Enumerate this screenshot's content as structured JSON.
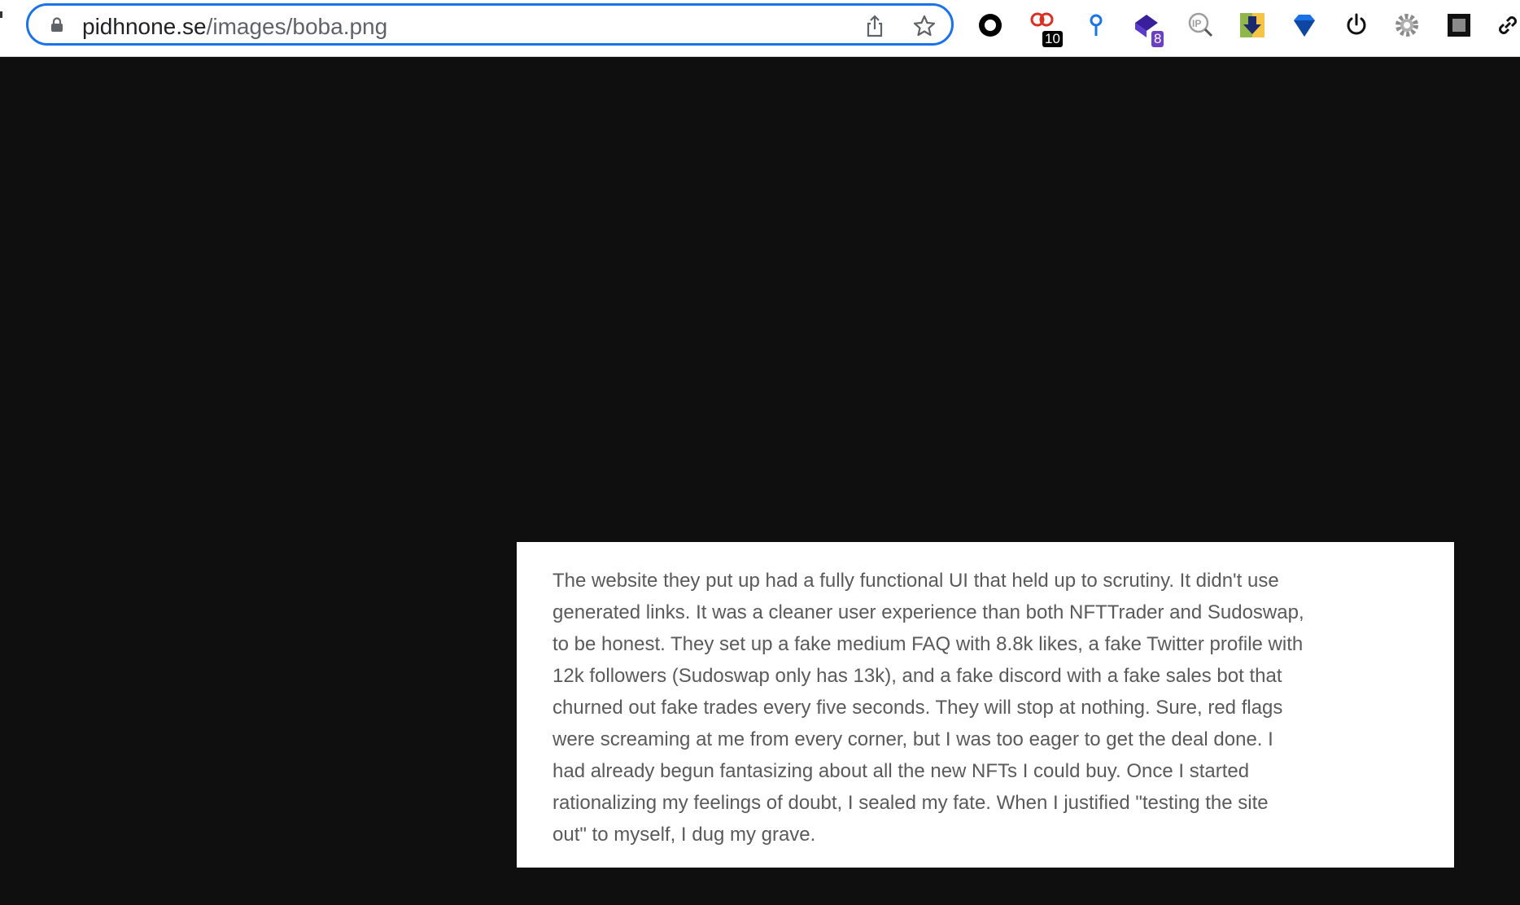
{
  "address_bar": {
    "domain": "pidhnone.se",
    "path": "/images/boba.png",
    "lock_icon": "lock-icon",
    "share_icon": "share-icon",
    "bookmark_icon": "star-icon"
  },
  "extensions": [
    {
      "icon": "ring-icon",
      "badge": ""
    },
    {
      "icon": "red-links-icon",
      "badge": "10"
    },
    {
      "icon": "pin-icon",
      "badge": ""
    },
    {
      "icon": "purple-diamond-icon",
      "badge": "8"
    },
    {
      "icon": "ip-search-icon",
      "badge": ""
    },
    {
      "icon": "download-arrow-icon",
      "badge": ""
    },
    {
      "icon": "blue-gem-icon",
      "badge": ""
    },
    {
      "icon": "power-icon",
      "badge": ""
    },
    {
      "icon": "gear-icon",
      "badge": ""
    },
    {
      "icon": "square-frame-icon",
      "badge": ""
    },
    {
      "icon": "link-icon",
      "badge": ""
    }
  ],
  "colors": {
    "accent": "#1a73e8",
    "page_background": "#0f0f0f",
    "badge_dark": "#000000",
    "badge_purple": "#6a3fc4"
  },
  "image_text": {
    "lines": [
      "The website they put up had a fully functional UI that held up to scrutiny. It didn't use",
      "generated links. It was a cleaner user experience than both NFTTrader and Sudoswap,",
      "to be honest. They set up a fake medium FAQ with 8.8k likes, a fake Twitter profile with",
      "12k followers (Sudoswap only has 13k), and a fake discord with a fake sales bot that",
      "churned out fake trades every five seconds. They will stop at nothing. Sure, red flags",
      "were screaming at me from every corner, but I was too eager to get the deal done. I",
      "had already begun fantasizing about all the new NFTs I could buy. Once I started",
      "rationalizing my feelings of doubt, I sealed my fate. When I justified \"testing the site",
      "out\" to myself, I dug my grave."
    ]
  }
}
